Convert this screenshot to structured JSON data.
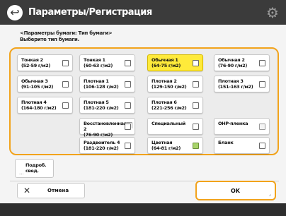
{
  "header": {
    "title": "Параметры/Регистрация",
    "back_icon": "back-arrow-icon",
    "settings_icon": "gear-icon"
  },
  "instructions": {
    "line1": "<Параметры бумаги: Тип бумаги>",
    "line2": "Выберите тип бумаги."
  },
  "paper_types": [
    {
      "label": "Тонкая 2\n(52-59 г/м2)",
      "icon": "single-sheet",
      "selected": false
    },
    {
      "label": "Тонкая 1\n(60-63 г/м2)",
      "icon": "single-sheet",
      "selected": false
    },
    {
      "label": "Обычная 1\n(64-75 г/м2)",
      "icon": "single-sheet",
      "selected": true
    },
    {
      "label": "Обычная 2\n(76-90 г/м2)",
      "icon": "single-sheet",
      "selected": false
    },
    {
      "label": "Обычная 3\n(91-105 г/м2)",
      "icon": "single-sheet",
      "selected": false
    },
    {
      "label": "Плотная 1\n(106-128 г/м2)",
      "icon": "single-sheet",
      "selected": false
    },
    {
      "label": "Плотная 2\n(129-150 г/м2)",
      "icon": "single-sheet",
      "selected": false
    },
    {
      "label": "Плотная 3\n(151-163 г/м2)",
      "icon": "single-sheet",
      "selected": false
    },
    {
      "label": "Плотная 4\n(164-180 г/м2)",
      "icon": "single-sheet",
      "selected": false
    },
    {
      "label": "Плотная 5\n(181-220 г/м2)",
      "icon": "single-sheet",
      "selected": false
    },
    {
      "label": "Плотная 6\n(221-256 г/м2)",
      "icon": "single-sheet",
      "selected": false
    },
    {
      "label": "Восстановленная 2\n(76-90 г/м2)",
      "icon": "recycled-sheet",
      "selected": false
    },
    {
      "label": "Специальный",
      "icon": "single-sheet",
      "selected": false
    },
    {
      "label": "OHP-пленка",
      "icon": "transparency",
      "selected": false
    },
    {
      "label": "Раздвоитель 4\n(181-220 г/м2)",
      "icon": "single-sheet",
      "selected": false
    },
    {
      "label": "Цветная\n(64-81 г/м2)",
      "icon": "color-sheet",
      "selected": false
    },
    {
      "label": "Бланк",
      "icon": "single-sheet",
      "selected": false
    }
  ],
  "details_button": {
    "label": "Подроб.\nсвед.",
    "dots": "..."
  },
  "footer": {
    "cancel_label": "Отмена",
    "ok_label": "OK"
  }
}
